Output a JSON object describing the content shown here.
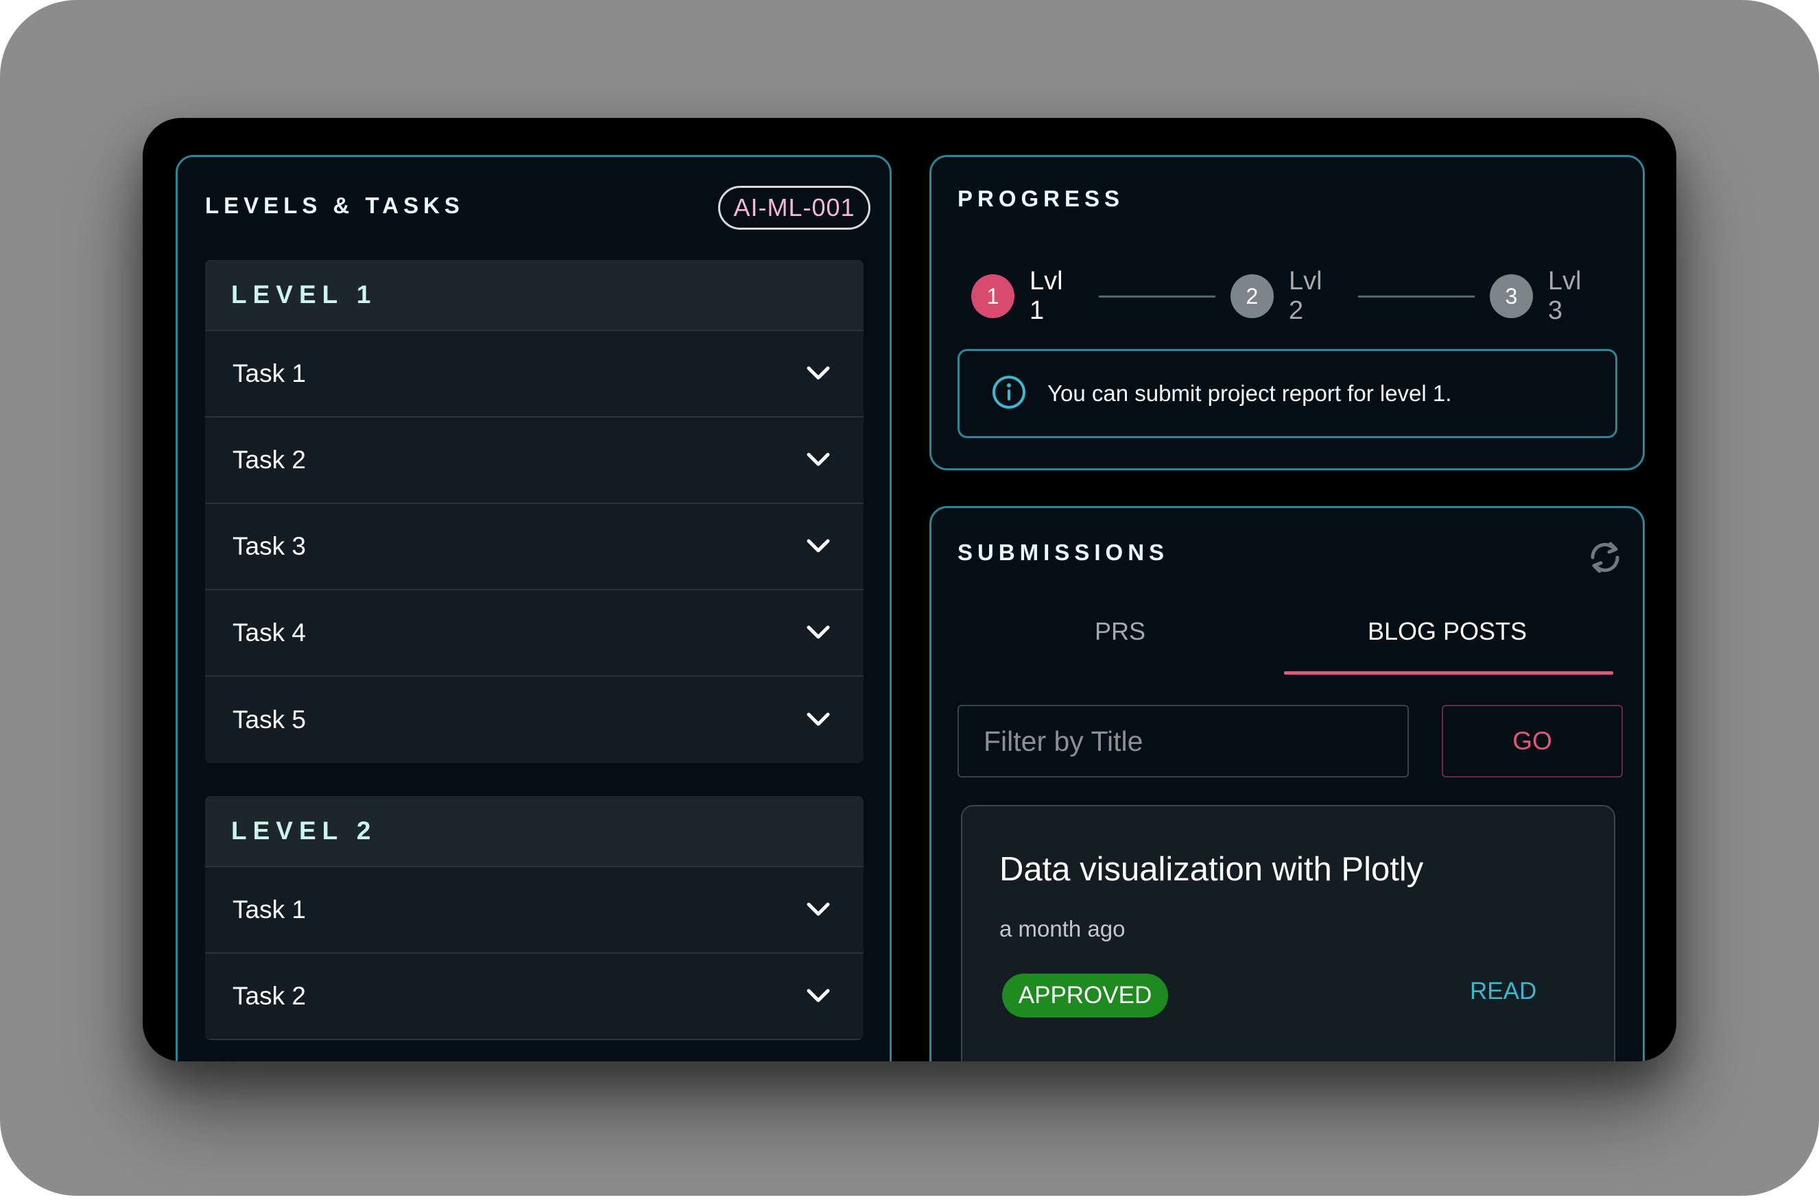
{
  "levels_panel": {
    "title": "LEVELS & TASKS",
    "project_code": "AI-ML-001",
    "levels": [
      {
        "label": "LEVEL 1",
        "tasks": [
          "Task 1",
          "Task 2",
          "Task 3",
          "Task 4",
          "Task 5"
        ]
      },
      {
        "label": "LEVEL 2",
        "tasks": [
          "Task 1",
          "Task 2"
        ]
      }
    ]
  },
  "progress_panel": {
    "title": "PROGRESS",
    "steps": [
      {
        "number": "1",
        "label": "Lvl 1",
        "state": "active",
        "color": "#d94a6f"
      },
      {
        "number": "2",
        "label": "Lvl 2",
        "state": "inactive",
        "color": "#7c8587"
      },
      {
        "number": "3",
        "label": "Lvl 3",
        "state": "inactive",
        "color": "#7c8587"
      }
    ],
    "info_message": "You can submit project report for level 1."
  },
  "submissions_panel": {
    "title": "SUBMISSIONS",
    "tabs": [
      {
        "label": "PRS",
        "selected": false
      },
      {
        "label": "BLOG POSTS",
        "selected": true
      }
    ],
    "filter": {
      "placeholder": "Filter by Title",
      "value": ""
    },
    "go_label": "GO",
    "posts": [
      {
        "title": "Data visualization with Plotly",
        "time": "a month ago",
        "status": "APPROVED",
        "action": "READ"
      }
    ]
  },
  "colors": {
    "accent_border": "#2a8799",
    "accent_pink": "#e0577d",
    "approved_green": "#1f8a1f",
    "link_cyan": "#3fb6cf"
  }
}
